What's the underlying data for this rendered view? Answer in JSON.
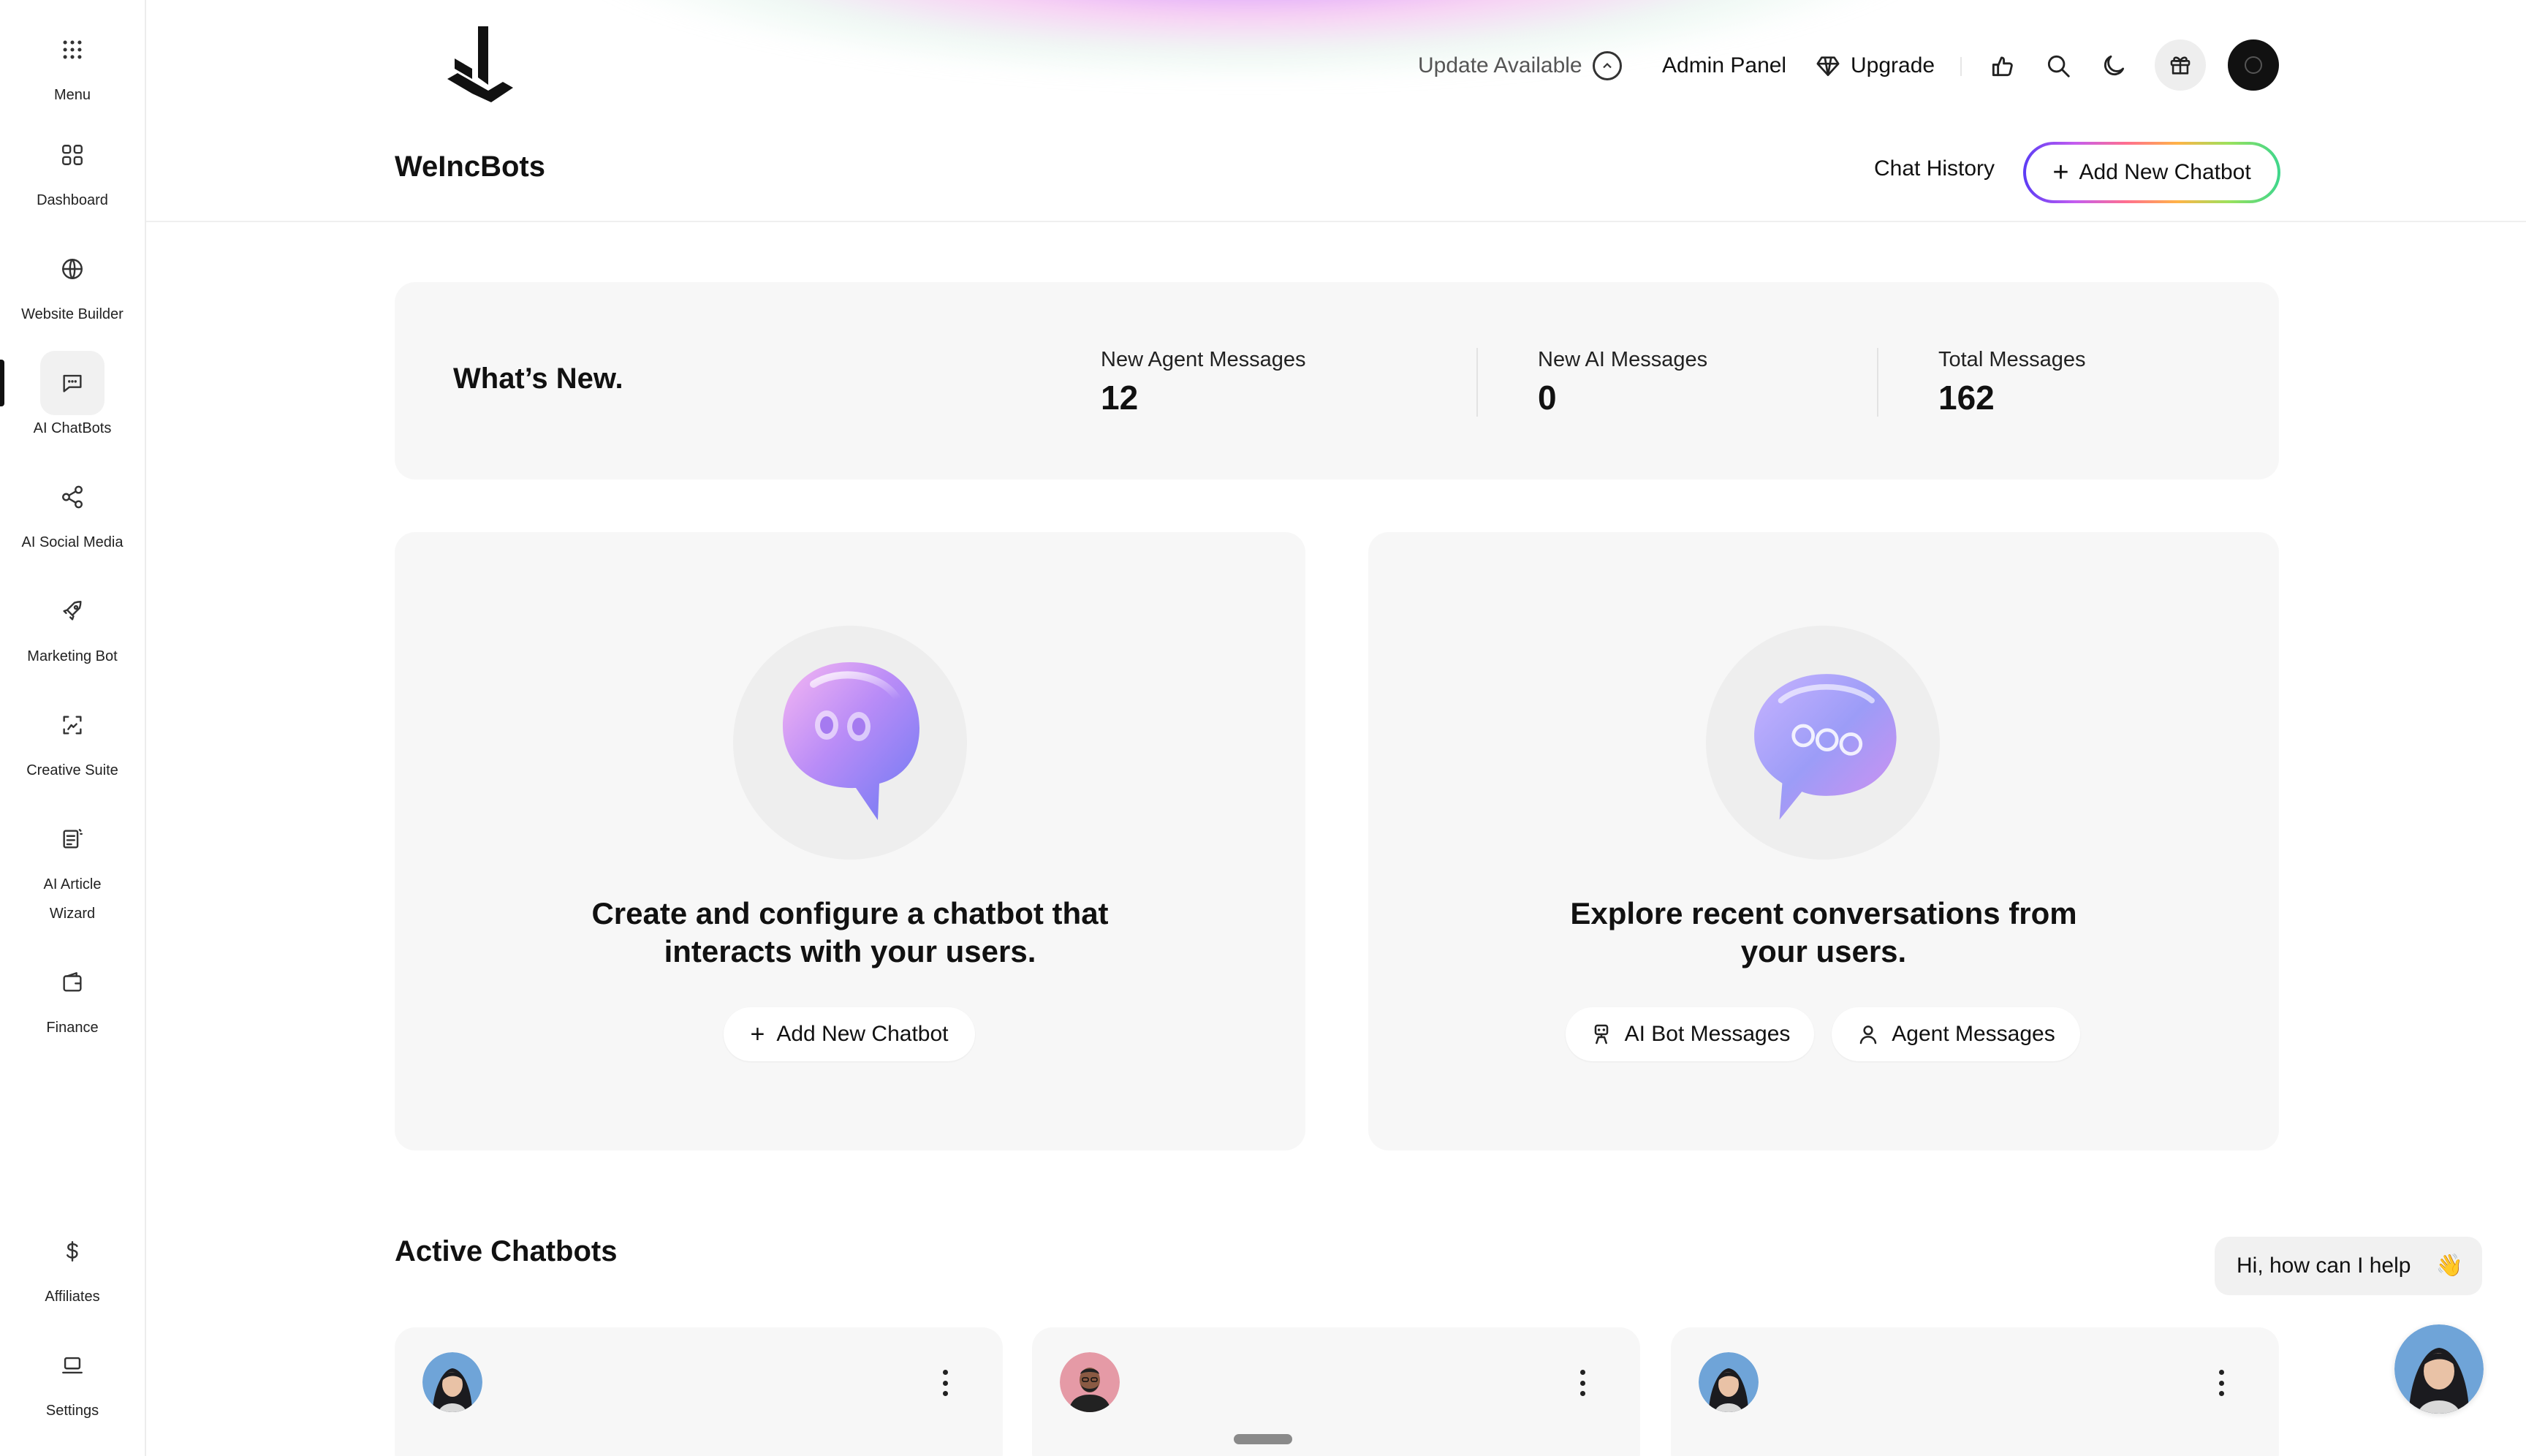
{
  "sidebar": {
    "items": [
      {
        "label": "Menu",
        "icon": "grid-dots-icon"
      },
      {
        "label": "Dashboard",
        "icon": "dashboard-icon"
      },
      {
        "label": "Website Builder",
        "icon": "globe-icon"
      },
      {
        "label": "AI ChatBots",
        "icon": "chat-icon",
        "active": true
      },
      {
        "label": "AI Social Media",
        "icon": "share-icon"
      },
      {
        "label": "Marketing Bot",
        "icon": "rocket-icon"
      },
      {
        "label": "Creative Suite",
        "icon": "image-frame-icon"
      },
      {
        "label": "AI Article Wizard",
        "icon": "article-icon"
      },
      {
        "label": "Finance",
        "icon": "wallet-icon"
      },
      {
        "label": "Affiliates",
        "icon": "dollar-icon"
      },
      {
        "label": "Settings",
        "icon": "laptop-icon"
      }
    ]
  },
  "header": {
    "update_label": "Update Available",
    "admin_label": "Admin Panel",
    "upgrade_label": "Upgrade",
    "page_title": "WeIncBots",
    "chat_history_label": "Chat History",
    "add_new_label": "Add New Chatbot"
  },
  "whats_new": {
    "title": "What’s New.",
    "stats": [
      {
        "label": "New Agent Messages",
        "value": "12"
      },
      {
        "label": "New AI Messages",
        "value": "0"
      },
      {
        "label": "Total Messages",
        "value": "162"
      }
    ]
  },
  "cards": {
    "create": {
      "text": "Create and configure a chatbot that interacts with your users.",
      "button_label": "Add New Chatbot"
    },
    "explore": {
      "text": "Explore recent conversations from your users.",
      "ai_button_label": "AI Bot Messages",
      "agent_button_label": "Agent Messages"
    }
  },
  "active_chatbots": {
    "title": "Active Chatbots"
  },
  "help_widget": {
    "message": "Hi, how can I help",
    "emoji": "👋"
  },
  "colors": {
    "accent_gradient": [
      "#5b3cf5",
      "#c35df0",
      "#ff6f8f",
      "#ffb347",
      "#9be15d",
      "#3dd68c"
    ],
    "card_bg": "#f7f7f7"
  }
}
